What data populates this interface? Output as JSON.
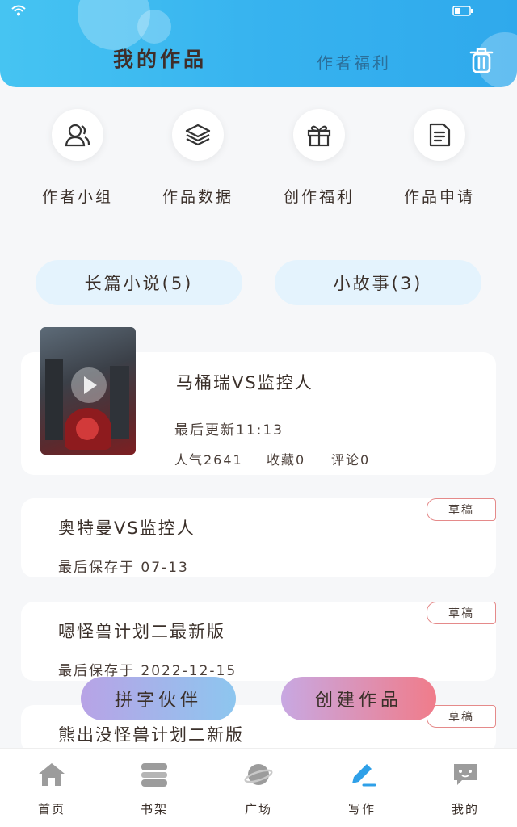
{
  "colors": {
    "header": "#37b3ef",
    "pill_bg": "#e4f3fd",
    "badge_border": "#e58a8a",
    "accent_blue": "#2fa0e8"
  },
  "header": {
    "tab_my_works": "我的作品",
    "tab_author_benefits": "作者福利"
  },
  "quick_actions": [
    {
      "label": "作者小组",
      "icon": "people-icon"
    },
    {
      "label": "作品数据",
      "icon": "layers-icon"
    },
    {
      "label": "创作福利",
      "icon": "gift-icon"
    },
    {
      "label": "作品申请",
      "icon": "document-icon"
    }
  ],
  "categories": {
    "long": "长篇小说(5)",
    "short": "小故事(3)"
  },
  "works": [
    {
      "title": "马桶瑞VS监控人",
      "updated": "最后更新11:13",
      "popularity": "人气2641",
      "favorites": "收藏0",
      "comments": "评论0"
    },
    {
      "title": "奥特曼VS监控人",
      "saved": "最后保存于 07-13",
      "badge": "草稿"
    },
    {
      "title": "嗯怪兽计划二最新版",
      "saved": "最后保存于 2022-12-15",
      "badge": "草稿"
    },
    {
      "title": "熊出没怪兽计划二新版",
      "badge": "草稿"
    }
  ],
  "floating": {
    "partner": "拼字伙伴",
    "create": "创建作品"
  },
  "nav": [
    {
      "label": "首页",
      "icon": "home-icon"
    },
    {
      "label": "书架",
      "icon": "bookshelf-icon"
    },
    {
      "label": "广场",
      "icon": "planet-icon"
    },
    {
      "label": "写作",
      "icon": "pen-icon"
    },
    {
      "label": "我的",
      "icon": "chat-face-icon"
    }
  ]
}
